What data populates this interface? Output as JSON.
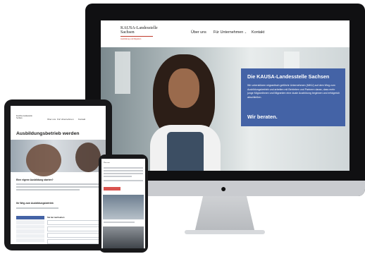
{
  "desktop": {
    "logo_title_1": "KAUSA-Landesstelle",
    "logo_title_2": "Sachsen",
    "logo_subtitle": "Ausbildung und Migration",
    "nav": [
      "Über uns",
      "Für Unternehmen",
      "Kontakt"
    ],
    "nav_dropdown_icon": "chevron-down-icon",
    "hero_card": {
      "heading": "Die KAUSA-Landesstelle Sachsen",
      "body": "Wir unterstützen migrantisch geführte Unternehmen (MiKU) auf dem Weg zum Ausbildungsbetrieb und arbeiten mit Betrieben und Partnern daran, dass mehr junge Migrantinnen und Migranten eine duale Ausbildung beginnen und erfolgreich abschließen.",
      "cta": "Wir beraten."
    },
    "colors": {
      "accent": "#4463a6",
      "brand_red": "#c0392b"
    }
  },
  "tablet": {
    "page_title": "Ausbildungsbetrieb werden",
    "section_heading": "Eine eigene Ausbildung starten?",
    "section_heading_2": "Ihr Weg zum Ausbildungsbetrieb",
    "form_heading": "Sie bei nachsehen"
  },
  "phone": {
    "heading": "Über uns"
  },
  "device_icon": "apple-logo-icon"
}
